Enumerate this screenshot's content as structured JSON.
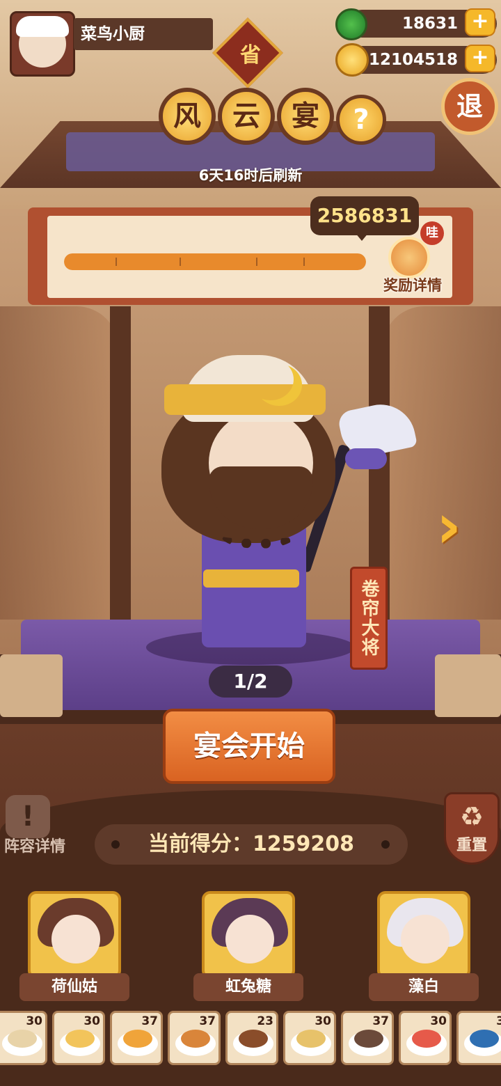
{
  "player": {
    "name": "菜鸟小厨",
    "province_badge": "省"
  },
  "currencies": {
    "jade": {
      "value": "18631",
      "icon": "jade-icon"
    },
    "coins": {
      "value": "12104518",
      "icon": "coin-icon"
    },
    "plus_label": "+"
  },
  "exit_label": "退",
  "event": {
    "title_chars": [
      "风",
      "云",
      "宴"
    ],
    "help_label": "?",
    "refresh_text": "6天16时后刷新"
  },
  "progress": {
    "target_score": "2586831",
    "fraction": 1.0,
    "wow_badge": "哇",
    "reward_label": "奖励详情"
  },
  "character": {
    "name": "卷帘大将",
    "page": "1/2",
    "next_icon": "chevron-right-icon"
  },
  "start_button": "宴会开始",
  "lineup_label": "阵容详情",
  "reset_label": "重置",
  "current_score": {
    "label": "当前得分：",
    "value": "1259208"
  },
  "guests": [
    {
      "name": "荷仙姑",
      "hair_color": "#6a3b2c"
    },
    {
      "name": "虹兔糖",
      "hair_color": "#5b3a55"
    },
    {
      "name": "藻白",
      "hair_color": "#e9e6ee"
    }
  ],
  "dishes": [
    {
      "count": "30",
      "color": "#e8d3a8"
    },
    {
      "count": "30",
      "color": "#f2c45b"
    },
    {
      "count": "37",
      "color": "#f0a43a"
    },
    {
      "count": "37",
      "color": "#d9853a"
    },
    {
      "count": "23",
      "color": "#8a4d2a"
    },
    {
      "count": "30",
      "color": "#e7c26a"
    },
    {
      "count": "37",
      "color": "#6b4a3a"
    },
    {
      "count": "30",
      "color": "#e65a4a"
    },
    {
      "count": "3",
      "color": "#2f6fb2"
    }
  ]
}
